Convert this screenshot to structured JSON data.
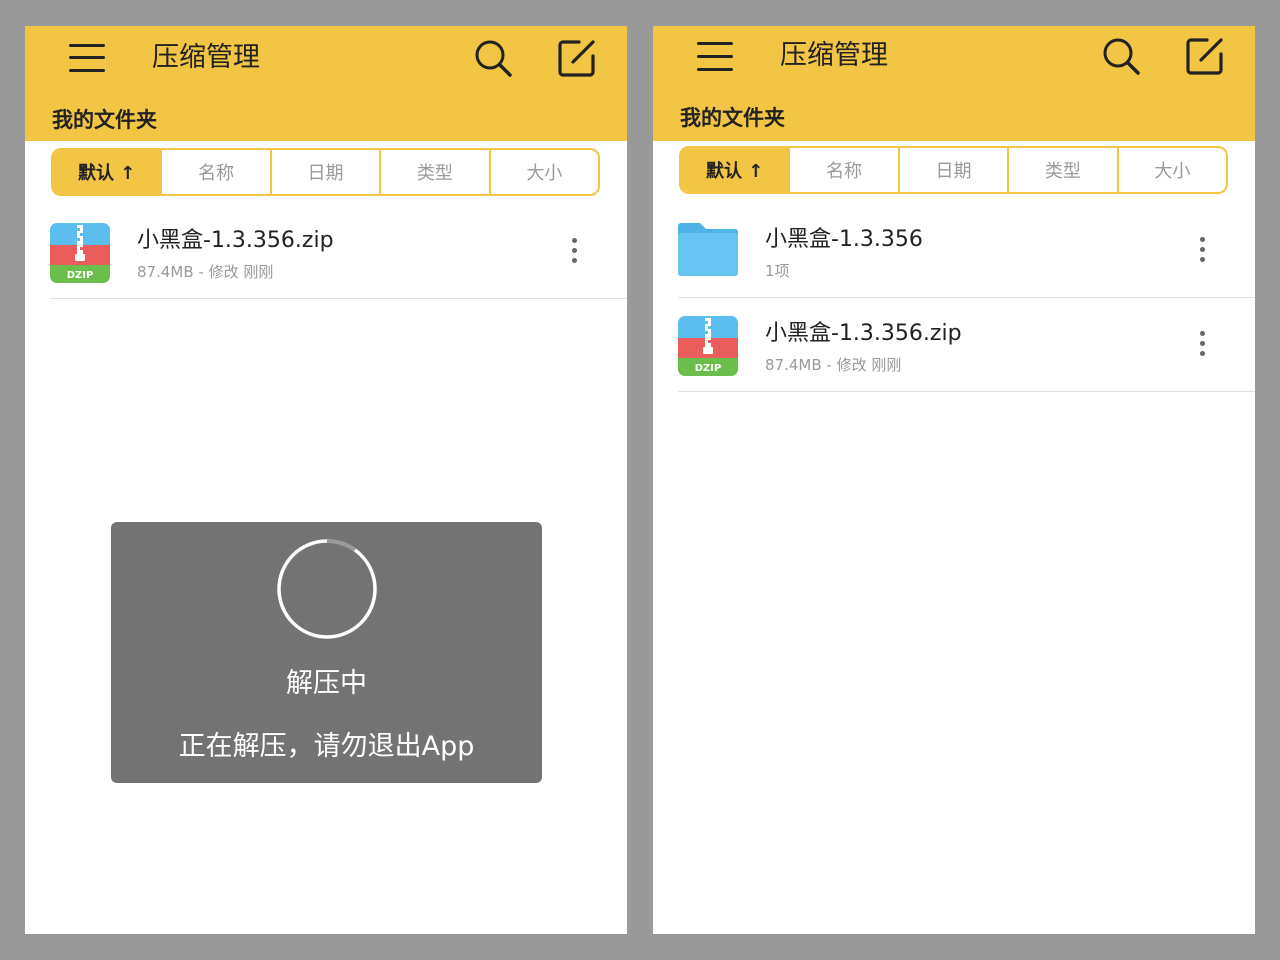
{
  "left": {
    "app_title": "压缩管理",
    "folder_title": "我的文件夹",
    "sort_tabs": [
      "默认 ↑",
      "名称",
      "日期",
      "类型",
      "大小"
    ],
    "files": [
      {
        "name": "小黑盒-1.3.356.zip",
        "meta": "87.4MB - 修改 刚刚",
        "icon": "zip-file-icon",
        "icon_label": "DZIP"
      }
    ],
    "dialog": {
      "title": "解压中",
      "message": "正在解压，请勿退出App",
      "progress": 0.1
    }
  },
  "right": {
    "app_title": "压缩管理",
    "folder_title": "我的文件夹",
    "sort_tabs": [
      "默认 ↑",
      "名称",
      "日期",
      "类型",
      "大小"
    ],
    "files": [
      {
        "name": "小黑盒-1.3.356",
        "meta": "1项",
        "icon": "folder-icon"
      },
      {
        "name": "小黑盒-1.3.356.zip",
        "meta": "87.4MB - 修改 刚刚",
        "icon": "zip-file-icon",
        "icon_label": "DZIP"
      }
    ]
  },
  "colors": {
    "accent": "#F3C544",
    "background": "#999999",
    "dialog": "#737373",
    "folder": "#67C4F3",
    "zip_blue": "#5BBEEE",
    "zip_red": "#E95D5D",
    "zip_green": "#6BBE4C"
  }
}
